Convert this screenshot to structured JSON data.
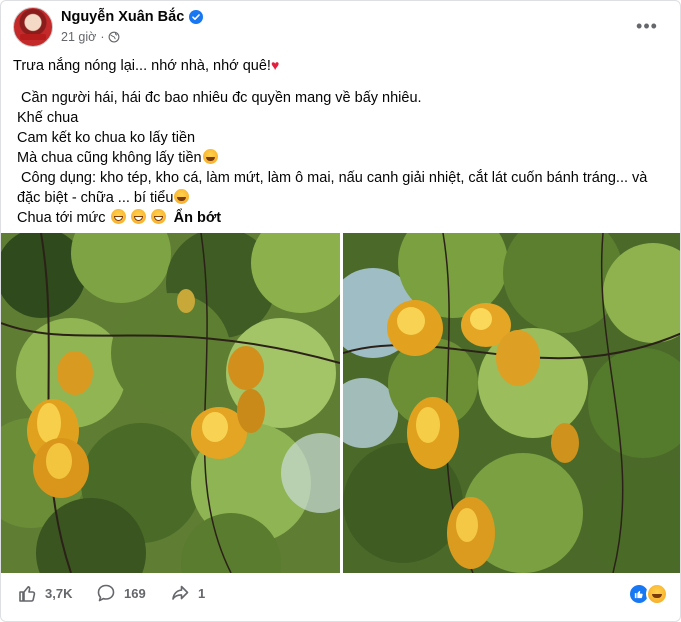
{
  "post": {
    "author": "Nguyễn Xuân Bắc",
    "time": "21 giờ",
    "separator": "·",
    "more_label": "•••",
    "lines": {
      "l1": "Trưa nắng nóng lại... nhớ nhà, nhớ quê!",
      "l2": " Cần người hái, hái đc bao nhiêu đc quyền mang về bấy nhiêu.",
      "l3": "Khế chua",
      "l4": "Cam kết ko chua ko lấy tiền",
      "l5": "Mà chua cũng không lấy tiền",
      "l6": " Công dụng: kho tép, kho cá, làm mứt, làm ô mai, nấu canh giải nhiệt, cắt lát cuốn bánh tráng... và đặc biệt - chữa ... bí tiểu",
      "l7": "Chua tới mức ",
      "see_less": "Ẩn bớt"
    }
  },
  "stats": {
    "likes": "3,7K",
    "comments": "169",
    "shares": "1"
  },
  "icons": {
    "verified": "verified-badge-icon",
    "globe": "globe-icon",
    "like": "thumbs-up-icon",
    "comment": "comment-bubble-icon",
    "share": "share-arrow-icon"
  },
  "colors": {
    "accent": "#1877f2",
    "heart": "#e41e3f",
    "muted": "#65676b"
  }
}
